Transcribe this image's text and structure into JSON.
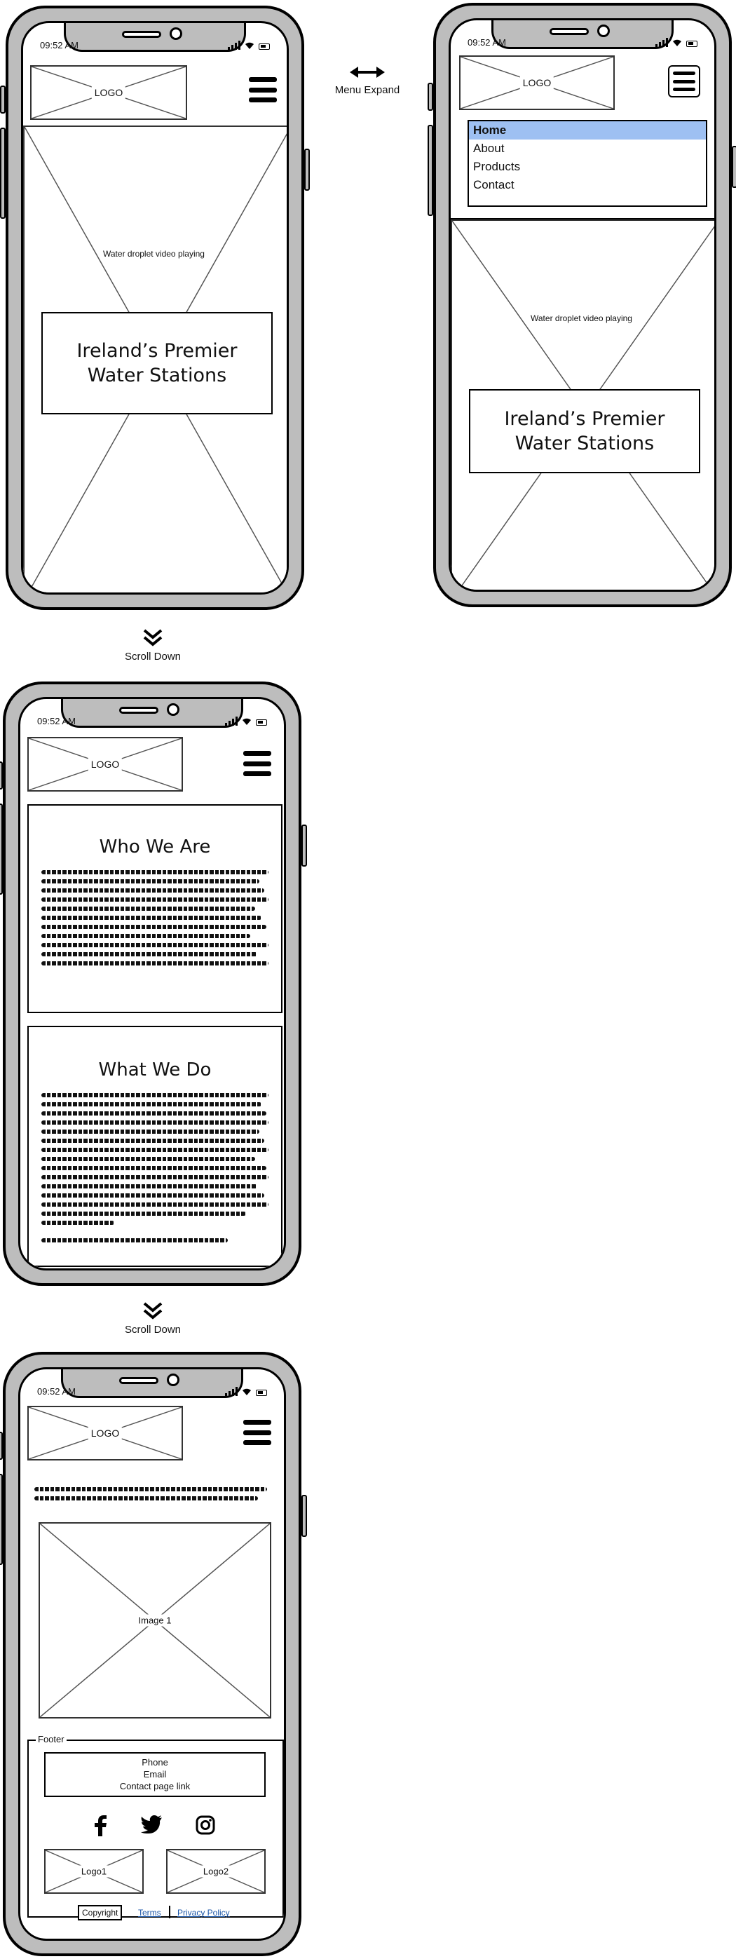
{
  "status_time": "09:52 AM",
  "logo_label": "LOGO",
  "hero_video_caption": "Water droplet video playing",
  "hero_title_line1": "Ireland’s Premier",
  "hero_title_line2": "Water Stations",
  "menu_expand_label": "Menu Expand",
  "menu_items": [
    "Home",
    "About",
    "Products",
    "Contact"
  ],
  "scroll_down_label": "Scroll Down",
  "who_we_are_title": "Who We Are",
  "what_we_do_title": "What We Do",
  "image_caption": "Image 1",
  "footer": {
    "legend": "Footer",
    "phone": "Phone",
    "email": "Email",
    "contact_link": "Contact page link",
    "logo1": "Logo1",
    "logo2": "Logo2",
    "copyright": "Copyright",
    "terms": "Terms",
    "privacy": "Privacy Policy"
  },
  "social_icons": [
    "facebook-icon",
    "twitter-icon",
    "instagram-icon"
  ],
  "highlight_color": "#9ec0f2",
  "frame_color": "#bdbdbd"
}
